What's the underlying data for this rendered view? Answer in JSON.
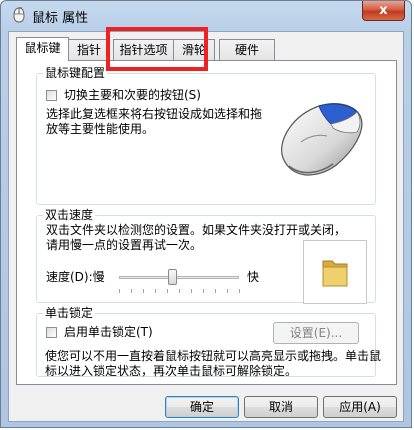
{
  "window": {
    "title": "鼠标 属性",
    "close_label": "x"
  },
  "tabs": [
    {
      "label": "鼠标键",
      "active": true
    },
    {
      "label": "指针",
      "active": false
    },
    {
      "label": "指针选项",
      "active": false
    },
    {
      "label": "滑轮",
      "active": false
    },
    {
      "label": "硬件",
      "active": false
    }
  ],
  "button_config": {
    "legend": "鼠标键配置",
    "switch_label": "切换主要和次要的按钮(S)",
    "description": "选择此复选框来将右按钮设成如选择和拖放等主要性能使用。"
  },
  "double_click": {
    "legend": "双击速度",
    "description": "双击文件夹以检测您的设置。如果文件夹没打开或关闭，请用慢一点的设置再试一次。",
    "speed_label": "速度(D):慢",
    "fast_label": "快",
    "speed_fraction": 0.44
  },
  "click_lock": {
    "legend": "单击锁定",
    "enable_label": "启用单击锁定(T)",
    "settings_label": "设置(E)...",
    "description": "使您可以不用一直按着鼠标按钮就可以高亮显示或拖拽。单击鼠标以进入锁定状态，再次单击鼠标可解除锁定。"
  },
  "footer": {
    "ok_label": "确定",
    "cancel_label": "取消",
    "apply_label": "应用(A)"
  },
  "colors": {
    "highlight": "#ee2222",
    "folder": "#e8c35a",
    "mouse_accent": "#2e5fd1"
  },
  "icons": {
    "title": "mouse-icon",
    "preview": "mouse-image",
    "folder": "folder-icon"
  }
}
